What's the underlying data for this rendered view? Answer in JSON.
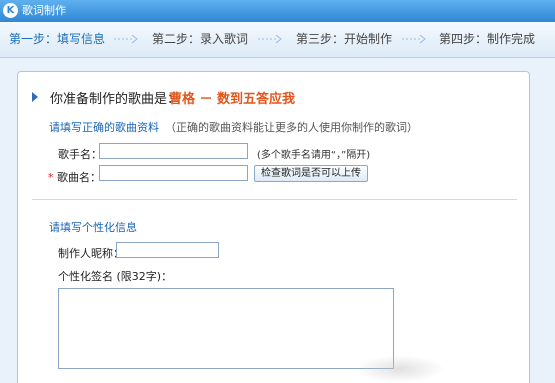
{
  "window": {
    "logo": "K",
    "title": "歌词制作"
  },
  "steps": [
    {
      "label": "第一步：填写信息"
    },
    {
      "label": "第二步：录入歌词"
    },
    {
      "label": "第三步：开始制作"
    },
    {
      "label": "第四步：制作完成"
    }
  ],
  "song": {
    "label": "你准备制作的歌曲是：",
    "value": "曹格 － 数到五答应我"
  },
  "song_info": {
    "title": "请填写正确的歌曲资料",
    "note": "（正确的歌曲资料能让更多的人使用你制作的歌词）",
    "singer_label": "歌手名：",
    "singer_value": "",
    "singer_hint": "(多个歌手名请用“，”隔开)",
    "song_required": "*",
    "song_label": "歌曲名：",
    "song_value": "",
    "check_button": "检查歌词是否可以上传"
  },
  "personal_info": {
    "title": "请填写个性化信息",
    "nickname_label": "制作人昵称：",
    "nickname_value": "",
    "signature_label": "个性化签名 (限32字)：",
    "signature_value": ""
  },
  "colors": {
    "accent": "#1b66b3",
    "highlight": "#e0561b",
    "required": "#e02020"
  }
}
